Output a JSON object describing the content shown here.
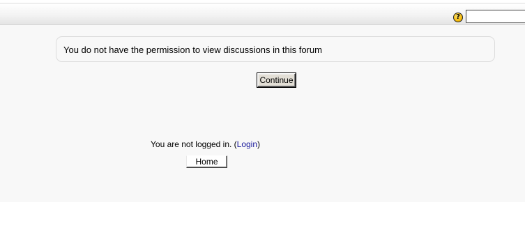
{
  "header": {
    "help_icon_glyph": "?",
    "search": {
      "value": "",
      "placeholder": ""
    }
  },
  "notice": {
    "message": "You do not have the permission to view discussions in this forum"
  },
  "actions": {
    "continue_label": "Continue"
  },
  "footer": {
    "login_status_prefix": "You are not logged in. (",
    "login_link_label": "Login",
    "login_status_suffix": ")",
    "home_label": "Home"
  },
  "colors": {
    "link": "#1a1a9c",
    "content_background": "#f8f8f8",
    "help_icon": "#f2b400"
  },
  "icons": {
    "help": "help-icon"
  }
}
